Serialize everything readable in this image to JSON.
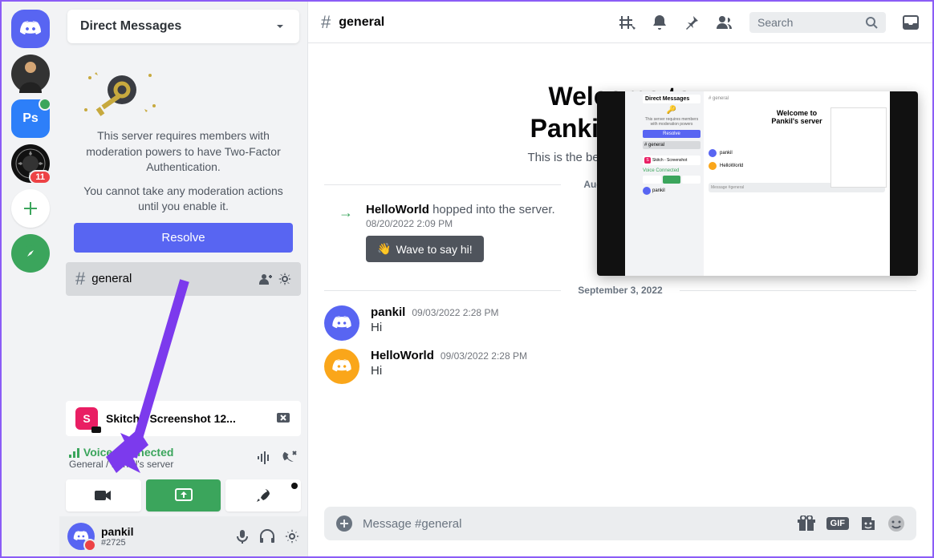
{
  "servers": {
    "ps_label": "Ps",
    "fifa_badge": "11"
  },
  "dm_header": "Direct Messages",
  "moderation": {
    "line1": "This server requires members with moderation powers to have Two-Factor Authentication.",
    "line2": "You cannot take any moderation actions until you enable it.",
    "resolve": "Resolve"
  },
  "channel": {
    "name": "general"
  },
  "voice_user": {
    "initial": "S",
    "label": "Skitch - Screenshot 12..."
  },
  "voice_status": {
    "title": "Voice Connected",
    "subtitle": "General / Pankil's server"
  },
  "user_panel": {
    "name": "pankil",
    "tag": "#2725"
  },
  "chat_header": {
    "channel": "general",
    "search_placeholder": "Search"
  },
  "welcome": {
    "title_line1": "Welcome to",
    "title_line2": "Pankil's server",
    "subtitle": "This is the beginning of this server."
  },
  "dates": {
    "d1": "August 20, 2022",
    "d2": "September 3, 2022"
  },
  "system_message": {
    "user": "HelloWorld",
    "text": "hopped into the server.",
    "timestamp": "08/20/2022 2:09 PM",
    "wave_label": "Wave to say hi!"
  },
  "messages": [
    {
      "author": "pankil",
      "ts": "09/03/2022 2:28 PM",
      "text": "Hi",
      "avatar": "p"
    },
    {
      "author": "HelloWorld",
      "ts": "09/03/2022 2:28 PM",
      "text": "Hi",
      "avatar": "h"
    }
  ],
  "input_placeholder": "Message #general",
  "gif_label": "GIF"
}
